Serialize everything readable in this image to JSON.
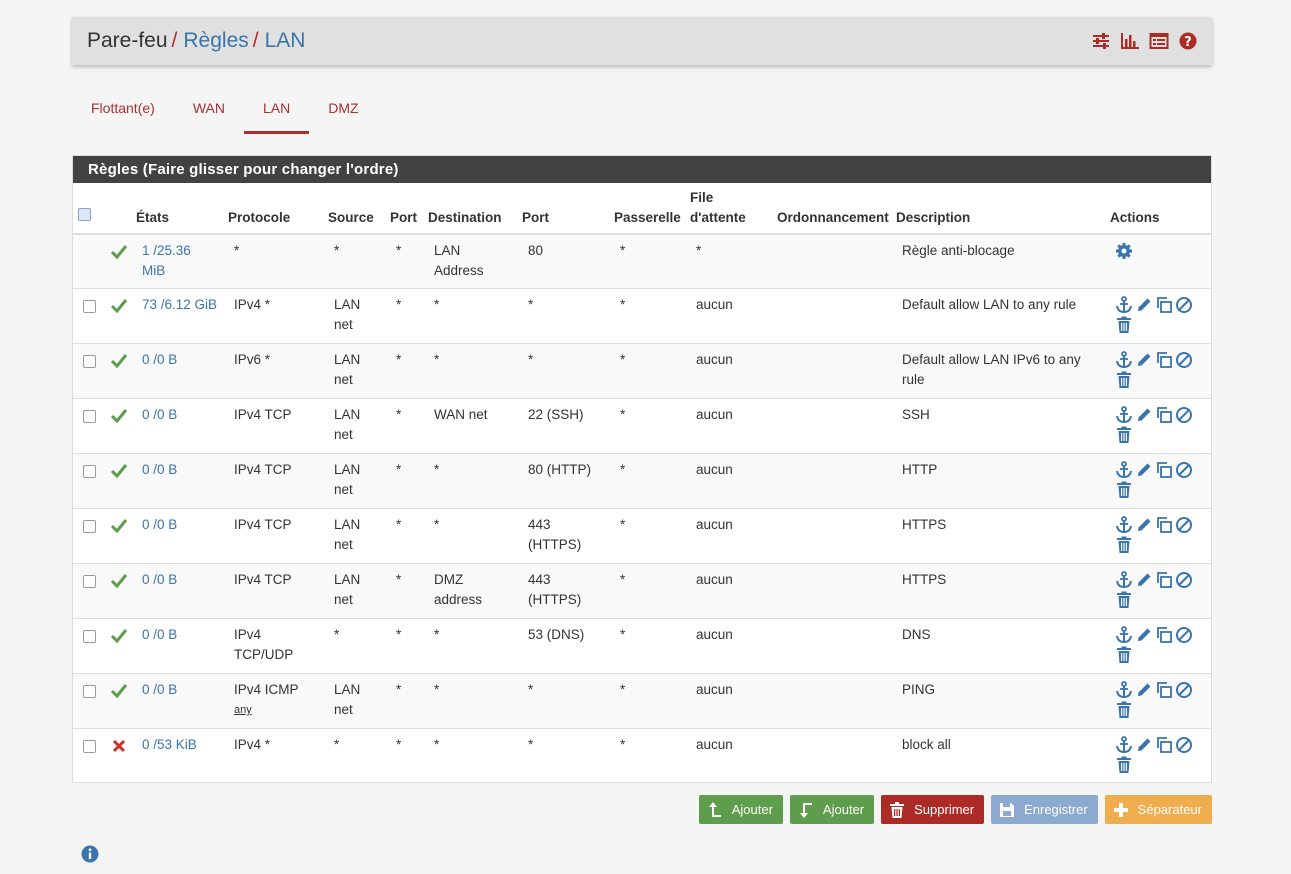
{
  "breadcrumb": {
    "root": "Pare-feu",
    "sep": "/",
    "level2": "Règles",
    "level3": "LAN"
  },
  "tabs": [
    {
      "label": "Flottant(e)"
    },
    {
      "label": "WAN"
    },
    {
      "label": "LAN",
      "active": true
    },
    {
      "label": "DMZ"
    }
  ],
  "panel": {
    "title": "Règles (Faire glisser pour changer l'ordre)"
  },
  "columns": {
    "states": "États",
    "protocol": "Protocole",
    "source": "Source",
    "port": "Port",
    "destination": "Destination",
    "dport": "Port",
    "gateway": "Passerelle",
    "queue_line1": "File",
    "queue_line2": "d'attente",
    "schedule": "Ordonnancement",
    "description": "Description",
    "actions": "Actions"
  },
  "rows": [
    {
      "status": "pass",
      "states": [
        "1 /25.36",
        "MiB"
      ],
      "protocol": [
        "*"
      ],
      "source": [
        "*"
      ],
      "port": "*",
      "destination": [
        "LAN",
        "Address"
      ],
      "dport": [
        "80"
      ],
      "gateway": "*",
      "queue": "*",
      "schedule": "",
      "description": [
        "Règle anti-blocage"
      ],
      "locked": true
    },
    {
      "status": "pass",
      "states": [
        "73 /6.12 GiB"
      ],
      "protocol": [
        "IPv4 *"
      ],
      "source": [
        "LAN",
        "net"
      ],
      "port": "*",
      "destination": [
        "*"
      ],
      "dport": [
        "*"
      ],
      "gateway": "*",
      "queue": "aucun",
      "schedule": "",
      "description": [
        "Default allow LAN to any rule"
      ]
    },
    {
      "status": "pass",
      "states": [
        "0 /0 B"
      ],
      "protocol": [
        "IPv6 *"
      ],
      "source": [
        "LAN",
        "net"
      ],
      "port": "*",
      "destination": [
        "*"
      ],
      "dport": [
        "*"
      ],
      "gateway": "*",
      "queue": "aucun",
      "schedule": "",
      "description": [
        "Default allow LAN IPv6 to any",
        "rule"
      ]
    },
    {
      "status": "pass",
      "states": [
        "0 /0 B"
      ],
      "protocol": [
        "IPv4 TCP"
      ],
      "source": [
        "LAN",
        "net"
      ],
      "port": "*",
      "destination": [
        "WAN net"
      ],
      "dport": [
        "22 (SSH)"
      ],
      "gateway": "*",
      "queue": "aucun",
      "schedule": "",
      "description": [
        "SSH"
      ]
    },
    {
      "status": "pass",
      "states": [
        "0 /0 B"
      ],
      "protocol": [
        "IPv4 TCP"
      ],
      "source": [
        "LAN",
        "net"
      ],
      "port": "*",
      "destination": [
        "*"
      ],
      "dport": [
        "80 (HTTP)"
      ],
      "gateway": "*",
      "queue": "aucun",
      "schedule": "",
      "description": [
        "HTTP"
      ]
    },
    {
      "status": "pass",
      "states": [
        "0 /0 B"
      ],
      "protocol": [
        "IPv4 TCP"
      ],
      "source": [
        "LAN",
        "net"
      ],
      "port": "*",
      "destination": [
        "*"
      ],
      "dport": [
        "443",
        "(HTTPS)"
      ],
      "gateway": "*",
      "queue": "aucun",
      "schedule": "",
      "description": [
        "HTTPS"
      ]
    },
    {
      "status": "pass",
      "states": [
        "0 /0 B"
      ],
      "protocol": [
        "IPv4 TCP"
      ],
      "source": [
        "LAN",
        "net"
      ],
      "port": "*",
      "destination": [
        "DMZ",
        "address"
      ],
      "dport": [
        "443",
        "(HTTPS)"
      ],
      "gateway": "*",
      "queue": "aucun",
      "schedule": "",
      "description": [
        "HTTPS"
      ]
    },
    {
      "status": "pass",
      "states": [
        "0 /0 B"
      ],
      "protocol": [
        "IPv4",
        "TCP/UDP"
      ],
      "source": [
        "*"
      ],
      "port": "*",
      "destination": [
        "*"
      ],
      "dport": [
        "53 (DNS)"
      ],
      "gateway": "*",
      "queue": "aucun",
      "schedule": "",
      "description": [
        "DNS"
      ]
    },
    {
      "status": "pass",
      "states": [
        "0 /0 B"
      ],
      "protocol": [
        "IPv4 ICMP"
      ],
      "protocol_sub": "any",
      "source": [
        "LAN",
        "net"
      ],
      "port": "*",
      "destination": [
        "*"
      ],
      "dport": [
        "*"
      ],
      "gateway": "*",
      "queue": "aucun",
      "schedule": "",
      "description": [
        "PING"
      ]
    },
    {
      "status": "block",
      "states": [
        "0 /53 KiB"
      ],
      "protocol": [
        "IPv4 *"
      ],
      "source": [
        "*"
      ],
      "port": "*",
      "destination": [
        "*"
      ],
      "dport": [
        "*"
      ],
      "gateway": "*",
      "queue": "aucun",
      "schedule": "",
      "description": [
        "block all"
      ]
    }
  ],
  "buttons": {
    "add_top": "Ajouter",
    "add_bottom": "Ajouter",
    "delete": "Supprimer",
    "save": "Enregistrer",
    "separator": "Séparateur"
  },
  "colors": {
    "brand_red": "#ad2b27",
    "link_blue": "#3a74ac",
    "pass_green": "#5e9d4b",
    "block_red": "#c9302c"
  }
}
